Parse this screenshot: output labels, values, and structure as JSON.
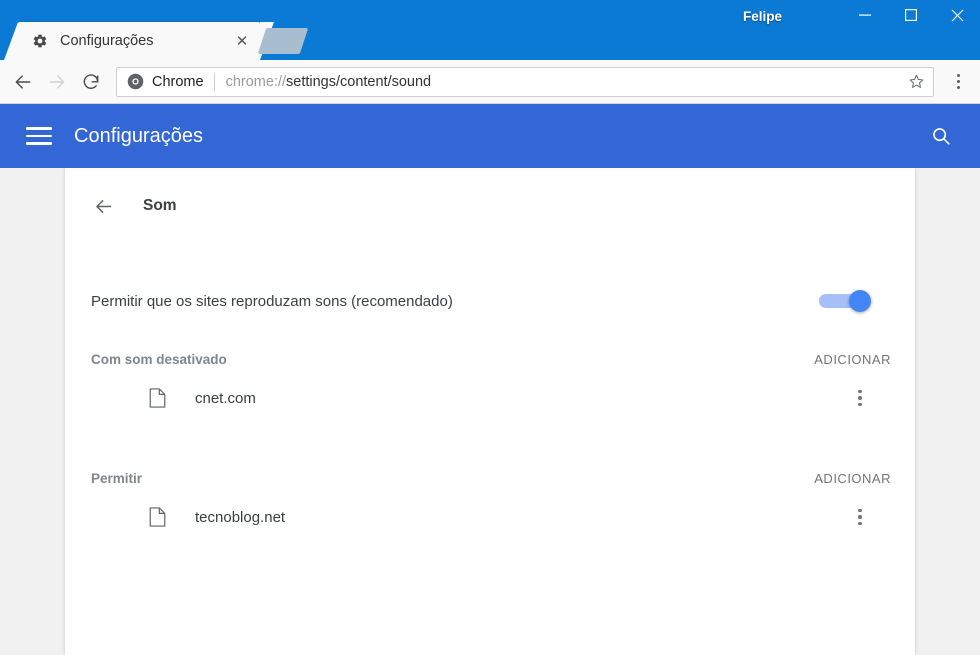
{
  "window": {
    "user_label": "Felipe",
    "minimize_label": "Minimizar",
    "maximize_label": "Maximizar",
    "close_label": "Fechar",
    "titlebar_color": "#0b7ad4"
  },
  "tab": {
    "title": "Configurações",
    "favicon": "gear-icon",
    "close_glyph": "✕",
    "new_tab_label": "Nova guia"
  },
  "toolbar": {
    "back_label": "Voltar",
    "forward_label": "Avançar",
    "reload_label": "Recarregar",
    "bookmark_label": "Favoritar",
    "menu_label": "Personalizar e controlar o Google Chrome",
    "omnibox": {
      "badge_label": "Chrome",
      "url_scheme": "chrome://",
      "url_path": "settings/content/sound",
      "full_url": "chrome://settings/content/sound"
    }
  },
  "settings_header": {
    "menu_label": "Menu",
    "title": "Configurações",
    "search_label": "Pesquisar nas configurações",
    "background_color": "#3367d6"
  },
  "content": {
    "back_label": "Voltar",
    "page_title": "Som",
    "toggle": {
      "label": "Permitir que os sites reproduzam sons (recomendado)",
      "state": "on",
      "accent_color": "#4285f4"
    },
    "sections": [
      {
        "title": "Com som desativado",
        "add_label": "ADICIONAR",
        "sites": [
          {
            "name": "cnet.com",
            "icon": "page-icon",
            "menu_label": "Mais ações"
          }
        ]
      },
      {
        "title": "Permitir",
        "add_label": "ADICIONAR",
        "sites": [
          {
            "name": "tecnoblog.net",
            "icon": "page-icon",
            "menu_label": "Mais ações"
          }
        ]
      }
    ]
  }
}
